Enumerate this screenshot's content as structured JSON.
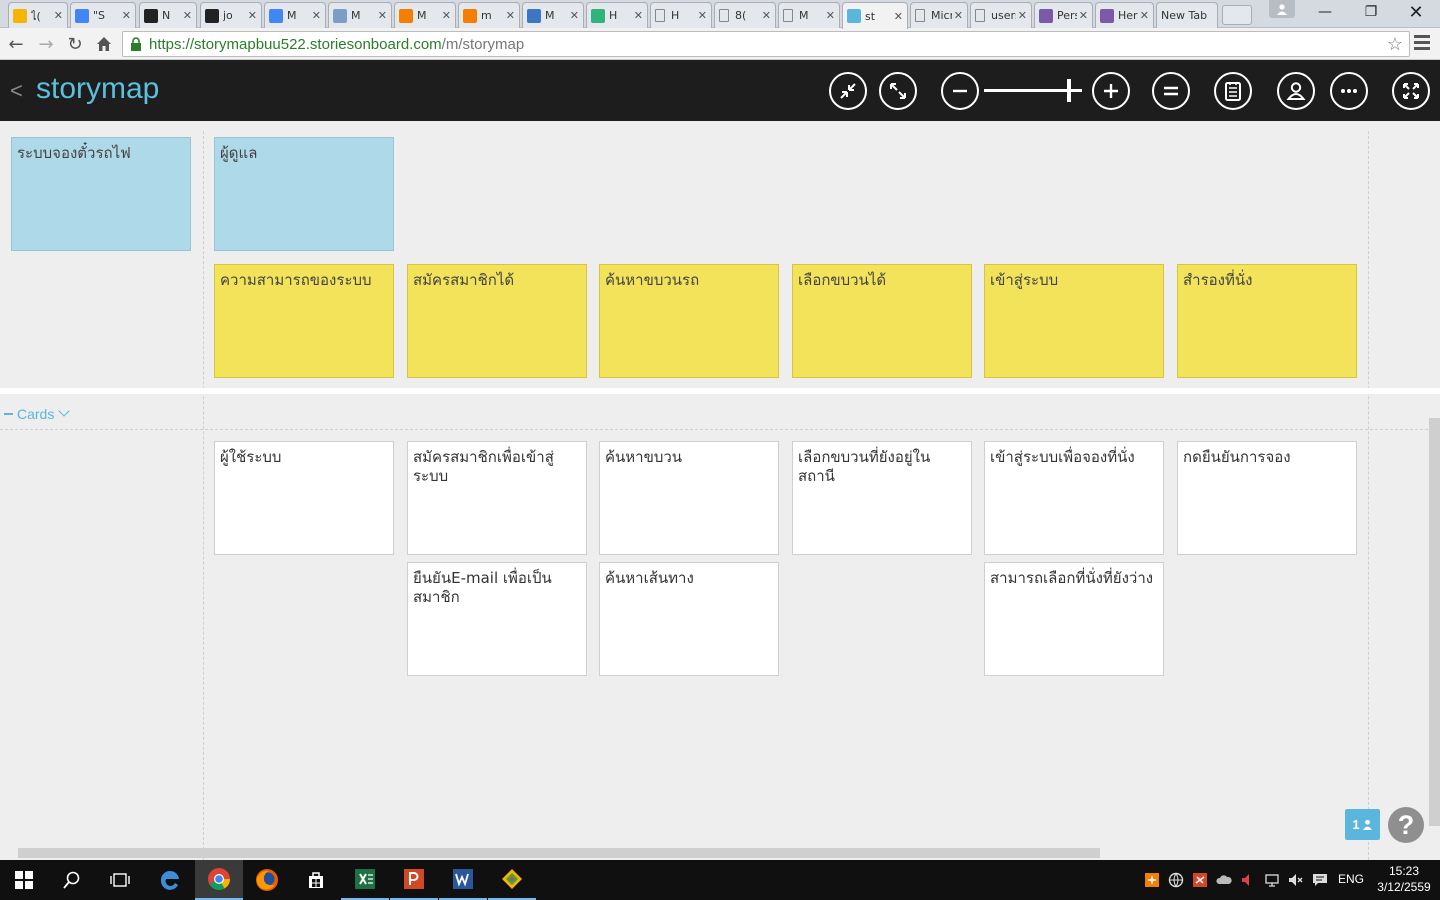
{
  "browser": {
    "tabs": [
      {
        "title": "ไ(",
        "color": "#f4b400"
      },
      {
        "title": "\"S",
        "color": "#4285f4"
      },
      {
        "title": "N",
        "color": "#222222"
      },
      {
        "title": "jo",
        "color": "#222222"
      },
      {
        "title": "M",
        "color": "#4285f4"
      },
      {
        "title": "M",
        "color": "#7b9ec9"
      },
      {
        "title": "M",
        "color": "#f57d00"
      },
      {
        "title": "m",
        "color": "#f57d00"
      },
      {
        "title": "M",
        "color": "#3b77c2"
      },
      {
        "title": "H",
        "color": "#2fb37d"
      },
      {
        "title": "H",
        "color": "doc"
      },
      {
        "title": "8(",
        "color": "doc"
      },
      {
        "title": "M",
        "color": "doc"
      },
      {
        "title": "st",
        "color": "#5bb6dd",
        "active": true
      },
      {
        "title": "Micro",
        "color": "doc"
      },
      {
        "title": "users",
        "color": "doc"
      },
      {
        "title": "Perso",
        "color": "#7a59a8"
      },
      {
        "title": "Hero",
        "color": "#7a59a8"
      },
      {
        "title": "New Tab",
        "color": "none"
      }
    ],
    "url_host": "https://storymapbuu522.storiesonboard.com",
    "url_path": "/m/storymap"
  },
  "app": {
    "title": "storymap",
    "zoom_level": 0.87
  },
  "board": {
    "activities": [
      "ระบบจองตั๋วรถไฟ",
      "ผู้ดูแล"
    ],
    "tasks": [
      "ความสามารถของระบบ",
      "สมัครสมาชิกได้",
      "ค้นหาขบวนรถ",
      "เลือกขบวนได้",
      "เข้าสู่ระบบ",
      "สำรองที่นั่ง"
    ],
    "release_name": "Cards",
    "stories_row1": [
      "ผู้ใช้ระบบ",
      "สมัครสมาชิกเพื่อเข้าสู่ระบบ",
      "ค้นหาขบวน",
      "เลือกขบวนที่ยังอยู่ในสถานี",
      "เข้าสู่ระบบเพื่อจองที่นั่ง",
      "กดยืนยันการจอง"
    ],
    "stories_row2": [
      "ยืนยันE-mail เพื่อเป็นสมาชิก",
      "ค้นหาเส้นทาง",
      "สามารถเลือกที่นั่งที่ยังว่าง"
    ],
    "user_count_badge": "1",
    "help_label": "?"
  },
  "colors": {
    "activity": "#aed9e8",
    "task": "#f2e35a",
    "story": "#ffffff",
    "accent": "#5bc0de",
    "header": "#1d1d1d"
  },
  "taskbar": {
    "lang": "ENG",
    "time": "15:23",
    "date": "3/12/2559"
  }
}
